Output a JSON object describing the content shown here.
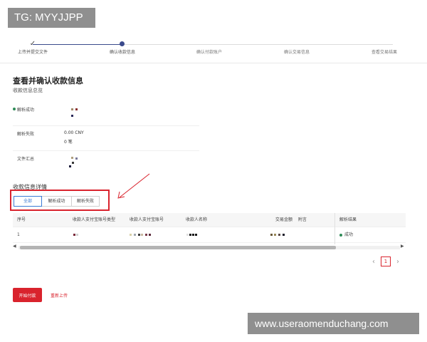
{
  "watermark_top": "TG: MYYJJPP",
  "watermark_bottom": "www.useraomenduchang.com",
  "stepper": {
    "steps": [
      {
        "label": "上传并提交文件",
        "state": "done"
      },
      {
        "label": "确认收款信息",
        "state": "current"
      },
      {
        "label": "确认付款账户",
        "state": "pending"
      },
      {
        "label": "确认交易信息",
        "state": "pending"
      },
      {
        "label": "查看交易结果",
        "state": "pending"
      }
    ]
  },
  "page": {
    "title": "查看并确认收款信息",
    "subtitle": "收款信息总览"
  },
  "summary": {
    "parse_success_label": "解析成功",
    "parse_fail_label": "解析失败",
    "parse_fail_amount": "0.00 CNY",
    "parse_fail_count": "0 笔",
    "file_summary_label": "文件汇总"
  },
  "details": {
    "title": "收款信息详情",
    "tabs": [
      "全部",
      "解析成功",
      "解析失败"
    ],
    "active_tab": 0
  },
  "table": {
    "columns": [
      "序号",
      "收款人支付宝账号类型",
      "收款人支付宝账号",
      "收款人名称",
      "交易金额",
      "附言",
      "解析结果"
    ],
    "rows": [
      {
        "index": "1",
        "result": "成功"
      }
    ]
  },
  "pagination": {
    "prev": "‹",
    "current": "1",
    "next": "›"
  },
  "actions": {
    "start_pay": "开始付款",
    "reupload": "重新上传"
  },
  "colors": {
    "primary": "#d9232d",
    "step_active": "#3a4a8c",
    "success": "#2e8b57",
    "tab_active": "#3a7bd5"
  }
}
